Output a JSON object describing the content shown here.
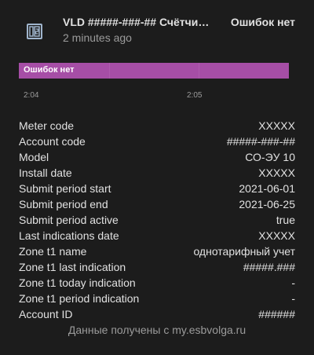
{
  "header": {
    "icon": "meter-icon",
    "title": "VLD #####-###-## Счётчи…",
    "last_changed": "2 minutes ago",
    "state": "Ошибок нет"
  },
  "timeline": {
    "bar_label": "Ошибок нет",
    "bar_color": "#a64ea6",
    "ticks": [
      "2:04",
      "2:05"
    ]
  },
  "attributes": [
    {
      "key": "Meter code",
      "value": "XXXXX"
    },
    {
      "key": "Account code",
      "value": "#####-###-##"
    },
    {
      "key": "Model",
      "value": "СО-ЭУ 10"
    },
    {
      "key": "Install date",
      "value": "XXXXX"
    },
    {
      "key": "Submit period start",
      "value": "2021-06-01"
    },
    {
      "key": "Submit period end",
      "value": "2021-06-25"
    },
    {
      "key": "Submit period active",
      "value": "true"
    },
    {
      "key": "Last indications date",
      "value": "XXXXX"
    },
    {
      "key": "Zone t1 name",
      "value": "однотарифный учет"
    },
    {
      "key": "Zone t1 last indication",
      "value": "#####.###"
    },
    {
      "key": "Zone t1 today indication",
      "value": "-"
    },
    {
      "key": "Zone t1 period indication",
      "value": "-"
    },
    {
      "key": "Account ID",
      "value": "######"
    }
  ],
  "footer": "Данные получены с my.esbvolga.ru"
}
